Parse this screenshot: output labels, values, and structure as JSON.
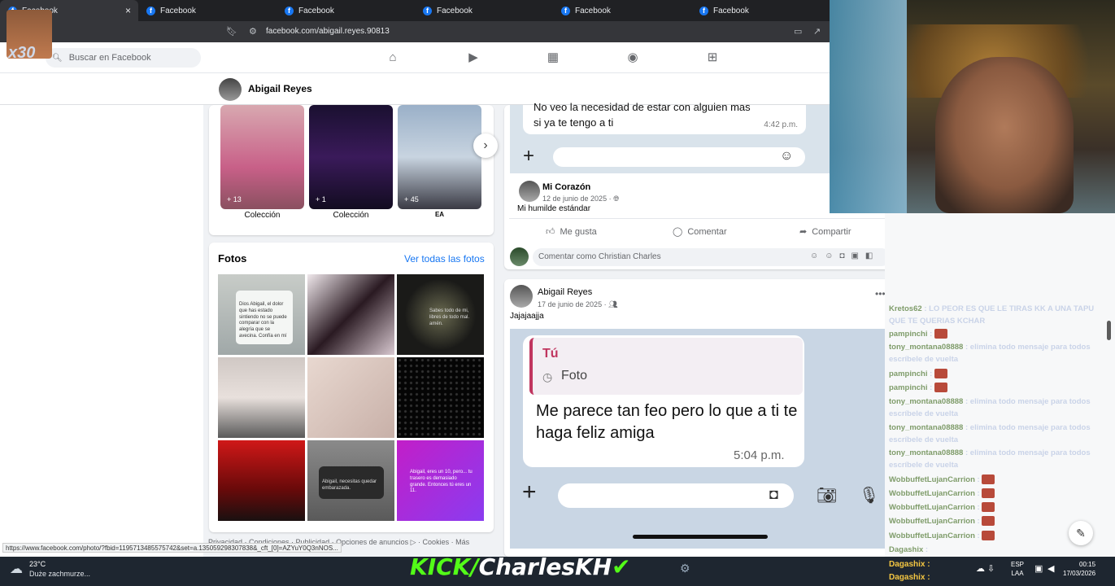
{
  "browser": {
    "tabs": [
      {
        "label": "Facebook"
      },
      {
        "label": "Facebook"
      },
      {
        "label": "Facebook"
      },
      {
        "label": "Facebook"
      },
      {
        "label": "Facebook"
      },
      {
        "label": "Facebook"
      }
    ],
    "url": "facebook.com/abigail.reyes.90813",
    "status_url": "https://www.facebook.com/photo/?fbid=1195713485575742&set=a.135059298307838&_cft_[0]=AZYuY0Q3nNOS..."
  },
  "overlay": {
    "multiplier": "x30"
  },
  "fbnav": {
    "search_placeholder": "Buscar en Facebook"
  },
  "profile": {
    "name": "Abigail Reyes"
  },
  "collections": [
    {
      "count": "+ 13",
      "label": "Colección"
    },
    {
      "count": "+ 1",
      "label": "Colección"
    },
    {
      "count": "+ 45",
      "label": "EA"
    }
  ],
  "photos": {
    "title": "Fotos",
    "link": "Ver todas las fotos",
    "p1_text": "Dios\nAbigail, el dolor que has estado sintiendo no se puede comparar con la alegría que se avecina. Confía en mí",
    "p3_text": "Sabes todo de mi, libres de todo mal. amén.",
    "p5_text": "Abigail, necesitas quedar embarazada.",
    "p6_text": "Abigail, eres un 10, pero... tu trasero es demasiado grande. Entonces tú eres un 11."
  },
  "footer": {
    "links": "Privacidad · Condiciones · Publicidad · Opciones de anuncios ▷ · Cookies · Más"
  },
  "post1": {
    "chat_text_line1": "No veo la necesidad de estar con alguien mas",
    "chat_text_line2": "si ya te tengo a ti",
    "chat_time": "4:42 p.m.",
    "comment_author": "Mi Corazón",
    "comment_date": "12 de junio de 2025 · ",
    "comment_text": "Mi humilde estándar",
    "like": "Me gusta",
    "comment": "Comentar",
    "share": "Compartir",
    "comment_placeholder": "Comentar como Christian Charles"
  },
  "post2": {
    "author": "Abigail Reyes",
    "date": "17 de junio de 2025 · ",
    "text": "Jajajaajja",
    "reply_who": "Tú",
    "reply_what": "Foto",
    "message": "Me parece tan feo pero lo que a ti te haga feliz amiga",
    "time": "5:04 p.m."
  },
  "chat": {
    "lines": [
      {
        "user": "Kretos62",
        "text": ": LO PEOR ES QUE LE TIRAS KK A UNA TAPU QUE TE QUERIAS KCHAR"
      },
      {
        "user": "pampinchi",
        "text": ": "
      },
      {
        "user": "tony_montana08888",
        "text": ": elimina todo mensaje para todos escríbele de vuelta"
      },
      {
        "user": "pampinchi",
        "text": ": "
      },
      {
        "user": "pampinchi",
        "text": ": "
      },
      {
        "user": "tony_montana08888",
        "text": ": elimina todo mensaje para todos escríbele de vuelta"
      },
      {
        "user": "tony_montana08888",
        "text": ": elimina todo mensaje para todos escríbele de vuelta"
      },
      {
        "user": "tony_montana08888",
        "text": ": elimina todo mensaje para todos escríbele de vuelta"
      },
      {
        "user": "WobbuffetLujanCarrion",
        "text": ": "
      },
      {
        "user": "WobbuffetLujanCarrion",
        "text": ": "
      },
      {
        "user": "WobbuffetLujanCarrion",
        "text": ": "
      },
      {
        "user": "WobbuffetLujanCarrion",
        "text": ": "
      },
      {
        "user": "WobbuffetLujanCarrion",
        "text": ": "
      },
      {
        "user": "Dagashix",
        "text": ": "
      }
    ],
    "dagashix_1": "Dagashix :",
    "dagashix_2": "Dagashix :"
  },
  "taskbar": {
    "temp": "23°C",
    "weather": "Duże zachmurze...",
    "kick_prefix": "KICK/",
    "kick_name": "CharlesKH",
    "lang_1": "ESP",
    "lang_2": "LAA",
    "time": "00:15",
    "date": "17/03/2026"
  },
  "colors": {
    "facebook_blue": "#1877f2",
    "kick_green": "#53fc18"
  }
}
